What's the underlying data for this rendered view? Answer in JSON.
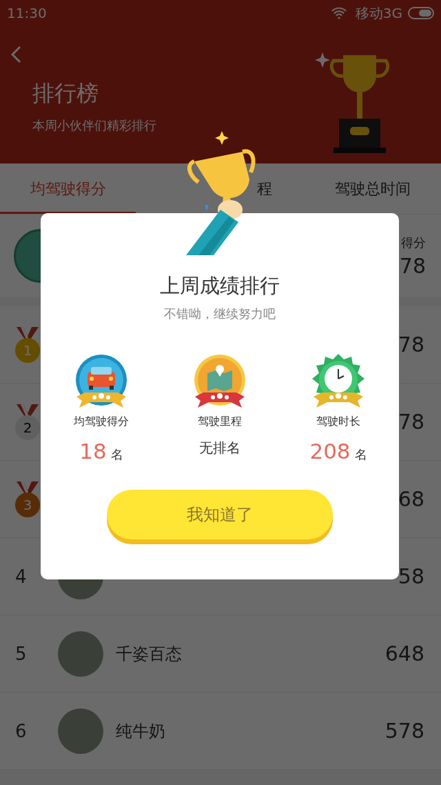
{
  "status_bar": {
    "time": "11:30",
    "carrier": "移动3G"
  },
  "header": {
    "title": "排行榜",
    "subtitle": "本周小伙伴们精彩排行"
  },
  "tabs": [
    {
      "label": "均驾驶得分",
      "selected": true
    },
    {
      "label": "程",
      "selected": false
    },
    {
      "label": "驾驶总时间",
      "selected": false
    }
  ],
  "my_rank": {
    "label": "得分",
    "score": "78"
  },
  "ranking": [
    {
      "rank": "1",
      "kind": "medal",
      "score": "78"
    },
    {
      "rank": "2",
      "kind": "medal",
      "score": "78"
    },
    {
      "rank": "3",
      "kind": "medal",
      "score": "68"
    },
    {
      "rank": "4",
      "kind": "number",
      "score": "58"
    },
    {
      "rank": "5",
      "kind": "number",
      "name": "千姿百态",
      "score": "648"
    },
    {
      "rank": "6",
      "kind": "number",
      "name": "纯牛奶",
      "score": "578"
    }
  ],
  "dialog": {
    "title": "上周成绩排行",
    "subtitle": "不错呦，继续努力吧",
    "stats": [
      {
        "label": "均驾驶得分",
        "kind": "ranked",
        "value": "18",
        "unit": "名"
      },
      {
        "label": "驾驶里程",
        "kind": "unranked",
        "value": "无排名"
      },
      {
        "label": "驾驶时长",
        "kind": "ranked",
        "value": "208",
        "unit": "名"
      }
    ],
    "button": "我知道了"
  }
}
